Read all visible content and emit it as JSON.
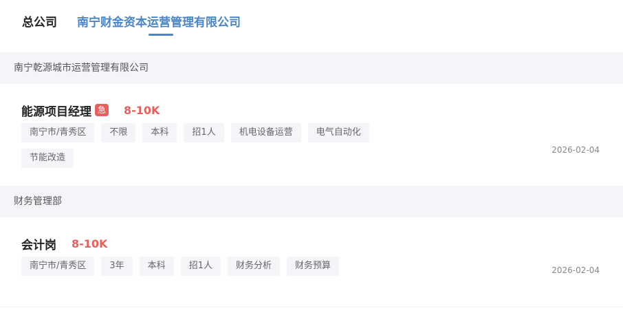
{
  "tabs": {
    "company": "总公司",
    "subsidiary": "南宁财金资本运营管理有限公司"
  },
  "sections": [
    {
      "name": "南宁乾源城市运营管理有限公司",
      "job": {
        "title": "能源项目经理",
        "urgent_badge": "急",
        "salary": "8-10K",
        "tags": [
          "南宁市/青秀区",
          "不限",
          "本科",
          "招1人",
          "机电设备运营",
          "电气自动化",
          "节能改造"
        ],
        "date": "2026-02-04"
      }
    },
    {
      "name": "财务管理部",
      "job": {
        "title": "会计岗",
        "salary": "8-10K",
        "tags": [
          "南宁市/青秀区",
          "3年",
          "本科",
          "招1人",
          "财务分析",
          "财务预算"
        ],
        "date": "2026-02-04"
      }
    }
  ],
  "colors": {
    "accent": "#4a86c5",
    "salary": "#e8605c",
    "section_bg": "#f3f5f9"
  }
}
